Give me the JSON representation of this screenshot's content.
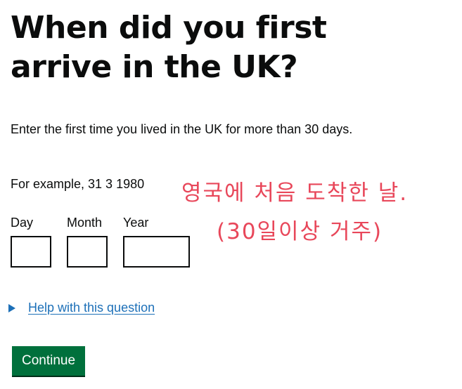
{
  "question": {
    "heading": "When did you first arrive in the UK?",
    "hint": "Enter the first time you lived in the UK for more than 30 days.",
    "example": "For example, 31 3 1980"
  },
  "date_input": {
    "day_label": "Day",
    "month_label": "Month",
    "year_label": "Year",
    "day_value": "",
    "month_value": "",
    "year_value": ""
  },
  "help": {
    "summary": "Help with this question"
  },
  "actions": {
    "continue_label": "Continue"
  },
  "annotation": {
    "line1": "영국에 처음 도착한 날.",
    "line2": "(30일이상 거주)",
    "color": "#e8475a"
  },
  "colors": {
    "link": "#1d70b8",
    "button": "#00703c",
    "text": "#0b0c0c"
  }
}
